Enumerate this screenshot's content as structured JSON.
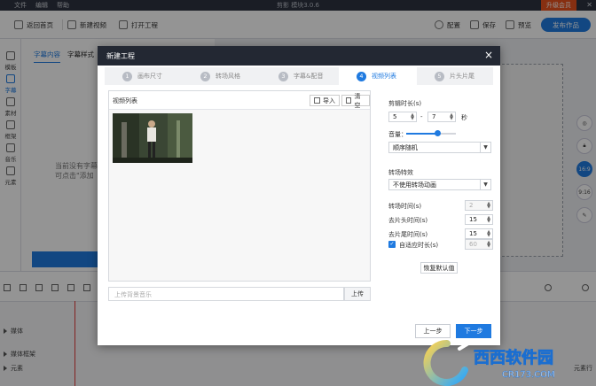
{
  "app": {
    "menu": [
      "文件",
      "编辑",
      "帮助"
    ],
    "title": "剪影 模块3.0.6",
    "upgrade_badge": "升级会员"
  },
  "toolbar": {
    "back_home": "返回首页",
    "new_video": "新建视频",
    "open_project": "打开工程",
    "settings": "配置",
    "save": "保存",
    "preview": "预览",
    "publish": "发布作品"
  },
  "leftbar": {
    "items": [
      {
        "label": "模板"
      },
      {
        "label": "字幕"
      },
      {
        "label": "素材"
      },
      {
        "label": "框架"
      },
      {
        "label": "音乐"
      },
      {
        "label": "元素"
      }
    ]
  },
  "panel": {
    "tabs": [
      "字幕内容",
      "字幕样式"
    ],
    "empty_line1": "当前没有字幕",
    "empty_line2": "可点击\"添加"
  },
  "rightrail": {
    "ratio_1": "16:9",
    "ratio_2": "9:16"
  },
  "timeline": {
    "tracks": [
      "媒体",
      "媒体框架",
      "元素"
    ],
    "right_label": "元素行"
  },
  "modal": {
    "title": "新建工程",
    "steps": [
      {
        "num": "1",
        "label": "画布尺寸"
      },
      {
        "num": "2",
        "label": "转场风格"
      },
      {
        "num": "3",
        "label": "字幕&配音"
      },
      {
        "num": "4",
        "label": "视频列表"
      },
      {
        "num": "5",
        "label": "片头片尾"
      }
    ],
    "active_step": 4,
    "video_list_label": "视频列表",
    "import_label": "导入",
    "clear_label": "清空",
    "music_placeholder": "上传背景音乐",
    "upload_label": "上传",
    "clip_duration_label": "剪辑时长(s)",
    "clip_min": "5",
    "clip_sep": "-",
    "clip_max": "7",
    "clip_unit": "秒",
    "volume_label": "音量：",
    "volume_level": 0.62,
    "order_value": "顺序随机",
    "transition_effect_label": "转场特效",
    "transition_value": "不使用转场动画",
    "transition_time_label": "转场时间(s)",
    "transition_time_value": "2",
    "remove_head_label": "去片头时间(s)",
    "remove_head_value": "15",
    "remove_tail_label": "去片尾时间(s)",
    "remove_tail_value": "15",
    "adaptive_label": "自适应时长(s)",
    "adaptive_value": "60",
    "adaptive_checked": true,
    "restore_label": "恢复默认值",
    "prev_label": "上一步",
    "next_label": "下一步"
  },
  "watermark": {
    "brand": "西西软件园",
    "domain": "CR173.COM"
  },
  "colors": {
    "accent": "#1f7ae0",
    "modal_header": "#232833",
    "menubar": "#2e3340",
    "upgrade": "#e8521e",
    "playhead": "#e23b3b"
  }
}
